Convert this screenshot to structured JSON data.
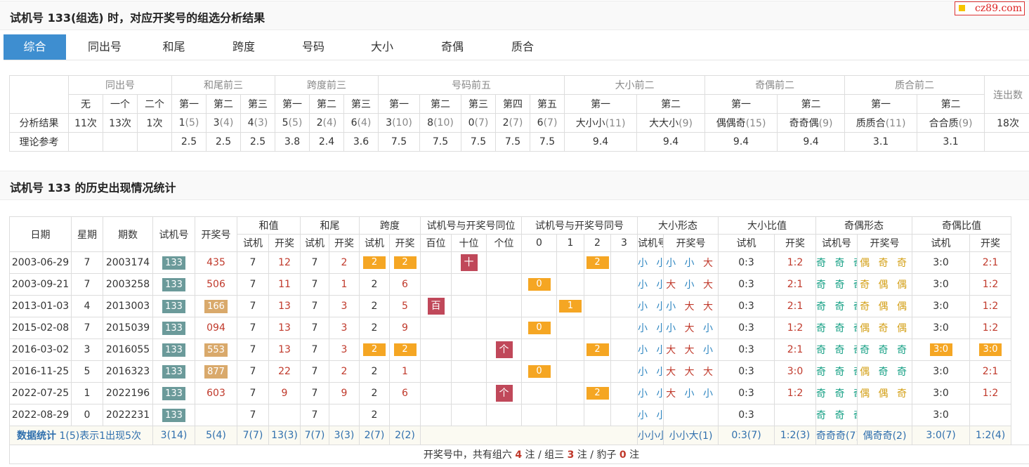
{
  "header1": {
    "title": "试机号 133(组选) 时，对应开奖号的组选分析结果"
  },
  "logo": {
    "text": "cz89.com"
  },
  "tabs": [
    {
      "label": "综合",
      "active": true
    },
    {
      "label": "同出号"
    },
    {
      "label": "和尾"
    },
    {
      "label": "跨度"
    },
    {
      "label": "号码"
    },
    {
      "label": "大小"
    },
    {
      "label": "奇偶"
    },
    {
      "label": "质合"
    }
  ],
  "summary": {
    "groups": [
      "同出号",
      "和尾前三",
      "跨度前三",
      "号码前五",
      "大小前二",
      "奇偶前二",
      "质合前二",
      "连出数"
    ],
    "sub_headers": {
      "tongchu": [
        "无",
        "一个",
        "二个"
      ],
      "hewei": [
        "第一",
        "第二",
        "第三"
      ],
      "kuadu": [
        "第一",
        "第二",
        "第三"
      ],
      "haoma": [
        "第一",
        "第二",
        "第三",
        "第四",
        "第五"
      ],
      "daxiao": [
        "第一",
        "第二"
      ],
      "jiou": [
        "第一",
        "第二"
      ],
      "zhihe": [
        "第一",
        "第二"
      ]
    },
    "row_labels": {
      "result": "分析结果",
      "theory": "理论参考"
    },
    "result": {
      "tongchu": [
        "11次",
        "13次",
        "1次"
      ],
      "hewei": [
        {
          "v": "1",
          "c": "(5)"
        },
        {
          "v": "3",
          "c": "(4)"
        },
        {
          "v": "4",
          "c": "(3)"
        }
      ],
      "kuadu": [
        {
          "v": "5",
          "c": "(5)"
        },
        {
          "v": "2",
          "c": "(4)"
        },
        {
          "v": "6",
          "c": "(4)"
        }
      ],
      "haoma": [
        {
          "v": "3",
          "c": "(10)"
        },
        {
          "v": "8",
          "c": "(10)"
        },
        {
          "v": "0",
          "c": "(7)"
        },
        {
          "v": "2",
          "c": "(7)"
        },
        {
          "v": "6",
          "c": "(7)"
        }
      ],
      "daxiao": [
        {
          "v": "大小小",
          "c": "(11)"
        },
        {
          "v": "大大小",
          "c": "(9)"
        }
      ],
      "jiou": [
        {
          "v": "偶偶奇",
          "c": "(15)"
        },
        {
          "v": "奇奇偶",
          "c": "(9)"
        }
      ],
      "zhihe": [
        {
          "v": "质质合",
          "c": "(11)"
        },
        {
          "v": "合合质",
          "c": "(9)"
        }
      ],
      "lianchu": "18次"
    },
    "theory": {
      "hewei": [
        "2.5",
        "2.5",
        "2.5"
      ],
      "kuadu": [
        "3.8",
        "2.4",
        "3.6"
      ],
      "haoma": [
        "7.5",
        "7.5",
        "7.5",
        "7.5",
        "7.5"
      ],
      "daxiao": [
        "9.4",
        "9.4"
      ],
      "jiou": [
        "9.4",
        "9.4"
      ],
      "zhihe": [
        "3.1",
        "3.1"
      ]
    }
  },
  "header2": {
    "title": "试机号 133 的历史出现情况统计"
  },
  "history": {
    "headers": {
      "date": "日期",
      "week": "星期",
      "issue": "期数",
      "trial": "试机号",
      "winning": "开奖号",
      "hezhi": "和值",
      "hewei": "和尾",
      "kuadu": "跨度",
      "same_pos": "试机号与开奖号同位",
      "same_num": "试机号与开奖号同号",
      "dx_form": "大小形态",
      "dx_ratio": "大小比值",
      "jo_form": "奇偶形态",
      "jo_ratio": "奇偶比值"
    },
    "sub": {
      "shiji": "试机",
      "kaijiang": "开奖",
      "pos": [
        "百位",
        "十位",
        "个位"
      ],
      "nums": [
        "0",
        "1",
        "2",
        "3"
      ],
      "trial_num": "试机号",
      "win_num": "开奖号"
    },
    "rows": [
      {
        "date": "2003-06-29",
        "week": "7",
        "issue": "2003174",
        "trial": "133",
        "win": "435",
        "win_style": "plain",
        "hz_s": "7",
        "hz_k": "12",
        "hw_s": "7",
        "hw_k": "2",
        "kd_s": "2",
        "kd_k": "2",
        "kd_box": true,
        "pos": [
          "",
          "十",
          ""
        ],
        "num": [
          "",
          "",
          "2",
          ""
        ],
        "dx_s": "小 小 小",
        "dx_k": "小 小 大",
        "dxr_s": "0:3",
        "dxr_k": "1:2",
        "jo_s": "奇 奇 奇",
        "jo_k": "偶 奇 奇",
        "jo_k_color": "gold",
        "jor_s": "3:0",
        "jor_k": "2:1",
        "jor_box": false
      },
      {
        "date": "2003-09-21",
        "week": "7",
        "issue": "2003258",
        "trial": "133",
        "win": "506",
        "win_style": "plain",
        "hz_s": "7",
        "hz_k": "11",
        "hw_s": "7",
        "hw_k": "1",
        "kd_s": "2",
        "kd_k": "6",
        "kd_box": false,
        "pos": [
          "",
          "",
          ""
        ],
        "num": [
          "0",
          "",
          "",
          ""
        ],
        "dx_s": "小 小 小",
        "dx_k": "大 小 大",
        "dxr_s": "0:3",
        "dxr_k": "2:1",
        "jo_s": "奇 奇 奇",
        "jo_k": "奇 偶 偶",
        "jo_k_color": "gold",
        "jor_s": "3:0",
        "jor_k": "1:2",
        "jor_box": false
      },
      {
        "date": "2013-01-03",
        "week": "4",
        "issue": "2013003",
        "trial": "133",
        "win": "166",
        "win_style": "box",
        "hz_s": "7",
        "hz_k": "13",
        "hw_s": "7",
        "hw_k": "3",
        "kd_s": "2",
        "kd_k": "5",
        "kd_box": false,
        "pos": [
          "百",
          "",
          ""
        ],
        "num": [
          "",
          "1",
          "",
          ""
        ],
        "dx_s": "小 小 小",
        "dx_k": "小 大 大",
        "dxr_s": "0:3",
        "dxr_k": "2:1",
        "jo_s": "奇 奇 奇",
        "jo_k": "奇 偶 偶",
        "jo_k_color": "gold",
        "jor_s": "3:0",
        "jor_k": "1:2",
        "jor_box": false
      },
      {
        "date": "2015-02-08",
        "week": "7",
        "issue": "2015039",
        "trial": "133",
        "win": "094",
        "win_style": "plain",
        "hz_s": "7",
        "hz_k": "13",
        "hw_s": "7",
        "hw_k": "3",
        "kd_s": "2",
        "kd_k": "9",
        "kd_box": false,
        "pos": [
          "",
          "",
          ""
        ],
        "num": [
          "0",
          "",
          "",
          ""
        ],
        "dx_s": "小 小 小",
        "dx_k": "小 大 小",
        "dxr_s": "0:3",
        "dxr_k": "1:2",
        "jo_s": "奇 奇 奇",
        "jo_k": "偶 奇 偶",
        "jo_k_color": "gold",
        "jor_s": "3:0",
        "jor_k": "1:2",
        "jor_box": false
      },
      {
        "date": "2016-03-02",
        "week": "3",
        "issue": "2016055",
        "trial": "133",
        "win": "553",
        "win_style": "box",
        "hz_s": "7",
        "hz_k": "13",
        "hw_s": "7",
        "hw_k": "3",
        "kd_s": "2",
        "kd_k": "2",
        "kd_box": true,
        "pos": [
          "",
          "",
          "个"
        ],
        "num": [
          "",
          "",
          "2",
          ""
        ],
        "dx_s": "小 小 小",
        "dx_k": "大 大 小",
        "dxr_s": "0:3",
        "dxr_k": "2:1",
        "jo_s": "奇 奇 奇",
        "jo_k": "奇 奇 奇",
        "jo_k_color": "green",
        "jor_s": "3:0",
        "jor_k": "3:0",
        "jor_box": true
      },
      {
        "date": "2016-11-25",
        "week": "5",
        "issue": "2016323",
        "trial": "133",
        "win": "877",
        "win_style": "box",
        "hz_s": "7",
        "hz_k": "22",
        "hw_s": "7",
        "hw_k": "2",
        "kd_s": "2",
        "kd_k": "1",
        "kd_box": false,
        "pos": [
          "",
          "",
          ""
        ],
        "num": [
          "0",
          "",
          "",
          ""
        ],
        "dx_s": "小 小 小",
        "dx_k": "大 大 大",
        "dxr_s": "0:3",
        "dxr_k": "3:0",
        "jo_s": "奇 奇 奇",
        "jo_k": "偶 奇 奇",
        "jo_k_color": "green",
        "jor_s": "3:0",
        "jor_k": "2:1",
        "jor_box": false
      },
      {
        "date": "2022-07-25",
        "week": "1",
        "issue": "2022196",
        "trial": "133",
        "win": "603",
        "win_style": "plain",
        "hz_s": "7",
        "hz_k": "9",
        "hw_s": "7",
        "hw_k": "9",
        "kd_s": "2",
        "kd_k": "6",
        "kd_box": false,
        "pos": [
          "",
          "",
          "个"
        ],
        "num": [
          "",
          "",
          "2",
          ""
        ],
        "dx_s": "小 小 小",
        "dx_k": "大 小 小",
        "dxr_s": "0:3",
        "dxr_k": "1:2",
        "jo_s": "奇 奇 奇",
        "jo_k": "偶 偶 奇",
        "jo_k_color": "gold",
        "jor_s": "3:0",
        "jor_k": "1:2",
        "jor_box": false
      },
      {
        "date": "2022-08-29",
        "week": "0",
        "issue": "2022231",
        "trial": "133",
        "win": "",
        "win_style": "plain",
        "hz_s": "7",
        "hz_k": "",
        "hw_s": "7",
        "hw_k": "",
        "kd_s": "2",
        "kd_k": "",
        "kd_box": false,
        "pos": [
          "",
          "",
          ""
        ],
        "num": [
          "",
          "",
          "",
          ""
        ],
        "dx_s": "小 小 小",
        "dx_k": "",
        "dxr_s": "0:3",
        "dxr_k": "",
        "jo_s": "奇 奇 奇",
        "jo_k": "",
        "jo_k_color": "gold",
        "jor_s": "3:0",
        "jor_k": "",
        "jor_box": false
      }
    ],
    "stats": {
      "label_bold": "数据统计",
      "label_rest": " 1(5)表示1出现5次",
      "trial": "3(14)",
      "win": "5(4)",
      "hz_s": "7(7)",
      "hz_k": "13(3)",
      "hw_s": "7(7)",
      "hw_k": "3(3)",
      "kd_s": "2(7)",
      "kd_k": "2(2)",
      "dx_s": "小小小(7)",
      "dx_k": "小小大(1)",
      "dxr_s": "0:3(7)",
      "dxr_k": "1:2(3)",
      "jo_s": "奇奇奇(7)",
      "jo_k": "偶奇奇(2)",
      "jor_s": "3:0(7)",
      "jor_k": "1:2(4)"
    },
    "footer": {
      "p1": "开奖号中，共有组六",
      "n1": "4",
      "p2": "注 / 组三",
      "n2": "3",
      "p3": "注 / 豹子",
      "n3": "0",
      "p4": "注"
    }
  }
}
